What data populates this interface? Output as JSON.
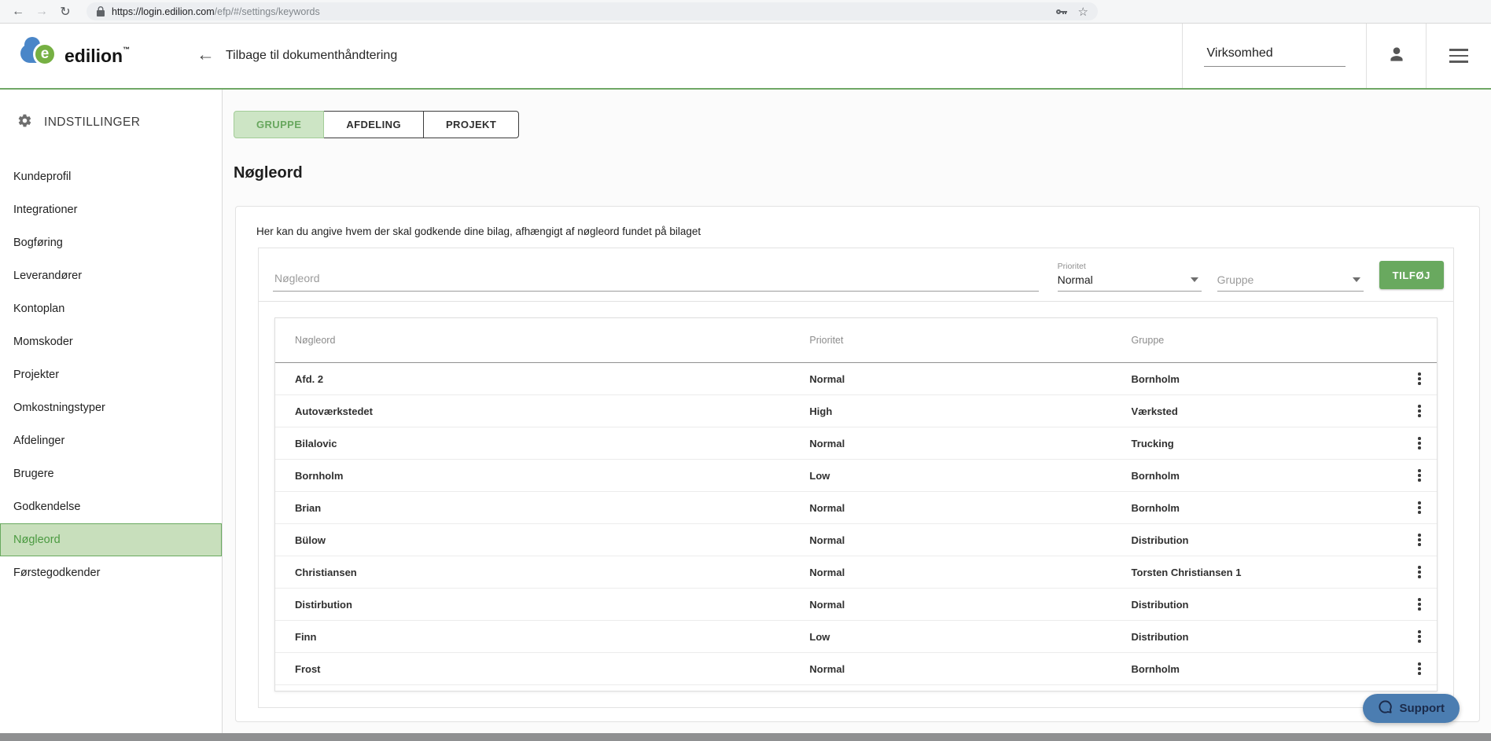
{
  "browser": {
    "url_domain": "https://login.edilion.com",
    "url_path": "/efp/#/settings/keywords",
    "url_full": "https://login.edilion.com/efp/#/settings/keywords"
  },
  "icons": {
    "back": "←",
    "forward": "→",
    "reload": "↻",
    "star": "☆",
    "header_back_arrow": "←"
  },
  "header": {
    "logo_text": "edilion",
    "logo_tm": "™",
    "logo_letter": "e",
    "back_link": "Tilbage til dokumenthåndtering",
    "company_label": "Virksomhed"
  },
  "sidebar": {
    "heading": "INDSTILLINGER",
    "items": [
      {
        "label": "Kundeprofil",
        "selected": false
      },
      {
        "label": "Integrationer",
        "selected": false
      },
      {
        "label": "Bogføring",
        "selected": false
      },
      {
        "label": "Leverandører",
        "selected": false
      },
      {
        "label": "Kontoplan",
        "selected": false
      },
      {
        "label": "Momskoder",
        "selected": false
      },
      {
        "label": "Projekter",
        "selected": false
      },
      {
        "label": "Omkostningstyper",
        "selected": false
      },
      {
        "label": "Afdelinger",
        "selected": false
      },
      {
        "label": "Brugere",
        "selected": false
      },
      {
        "label": "Godkendelse",
        "selected": false
      },
      {
        "label": "Nøgleord",
        "selected": true
      },
      {
        "label": "Førstegodkender",
        "selected": false
      }
    ]
  },
  "main": {
    "tabs": [
      {
        "label": "GRUPPE",
        "selected": true
      },
      {
        "label": "AFDELING",
        "selected": false
      },
      {
        "label": "PROJEKT",
        "selected": false
      }
    ],
    "page_title": "Nøgleord",
    "card": {
      "description": "Her kan du angive hvem der skal godkende dine bilag, afhængigt af nøgleord fundet på bilaget",
      "form": {
        "keyword_placeholder": "Nøgleord",
        "priority_label": "Prioritet",
        "priority_value": "Normal",
        "group_placeholder": "Gruppe",
        "add_button": "TILFØJ"
      },
      "table": {
        "headers": [
          "Nøgleord",
          "Prioritet",
          "Gruppe"
        ],
        "rows": [
          {
            "keyword": "Afd. 2",
            "priority": "Normal",
            "group": "Bornholm"
          },
          {
            "keyword": "Autoværkstedet",
            "priority": "High",
            "group": "Værksted"
          },
          {
            "keyword": "Bilalovic",
            "priority": "Normal",
            "group": "Trucking"
          },
          {
            "keyword": "Bornholm",
            "priority": "Low",
            "group": "Bornholm"
          },
          {
            "keyword": "Brian",
            "priority": "Normal",
            "group": "Bornholm"
          },
          {
            "keyword": "Bülow",
            "priority": "Normal",
            "group": "Distribution"
          },
          {
            "keyword": "Christiansen",
            "priority": "Normal",
            "group": "Torsten Christiansen 1"
          },
          {
            "keyword": "Distirbution",
            "priority": "Normal",
            "group": "Distribution"
          },
          {
            "keyword": "Finn",
            "priority": "Low",
            "group": "Distribution"
          },
          {
            "keyword": "Frost",
            "priority": "Normal",
            "group": "Bornholm"
          }
        ]
      }
    }
  },
  "support": {
    "label": "Support"
  },
  "colors": {
    "accent_green": "#69a95f",
    "light_green_bg": "#cde5c5",
    "sidebar_selected_bg": "#c8dfbc",
    "header_border_green": "#6fa765",
    "support_blue": "#4b7db1",
    "support_text": "#1b2b4b",
    "logo_blue": "#4a86c8",
    "logo_green": "#76b043"
  }
}
